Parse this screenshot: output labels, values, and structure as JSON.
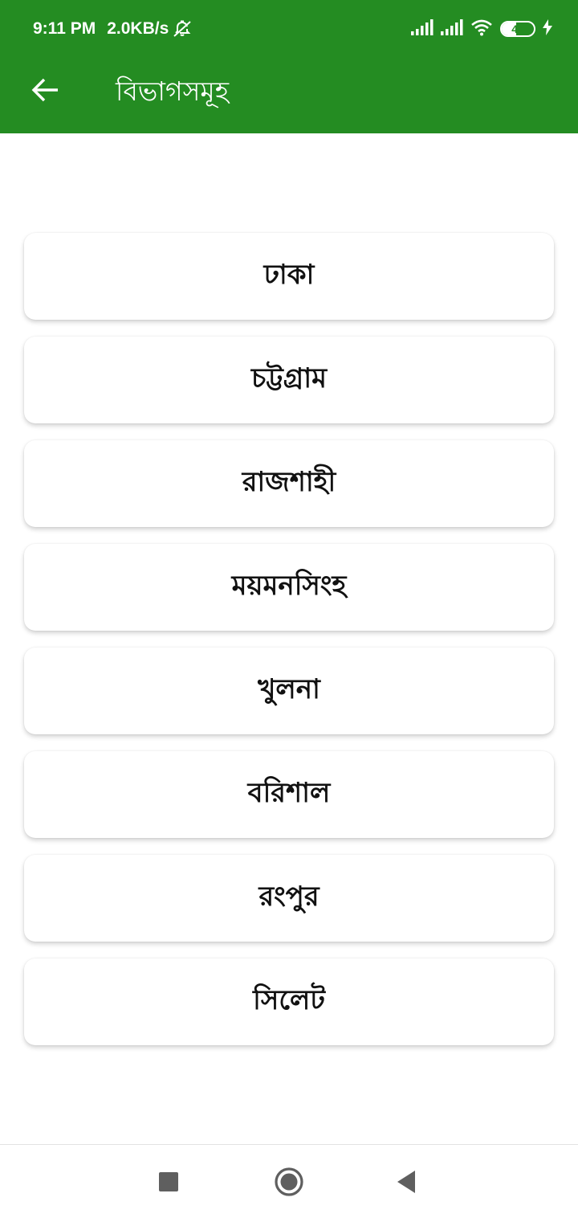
{
  "status_bar": {
    "time": "9:11 PM",
    "speed": "2.0KB/s",
    "battery_level": "44",
    "icons": [
      "mute-icon",
      "signal-icon",
      "signal-icon",
      "wifi-icon",
      "battery-icon",
      "charging-icon"
    ]
  },
  "app_bar": {
    "title": "বিভাগসমূহ",
    "back_icon": "arrow-left-icon"
  },
  "divisions": [
    "ঢাকা",
    "চট্টগ্রাম",
    "রাজশাহী",
    "ময়মনসিংহ",
    "খুলনা",
    "বরিশাল",
    "রংপুর",
    "সিলেট"
  ],
  "nav_bar": {
    "icons": [
      "recents-square-icon",
      "home-circle-icon",
      "back-triangle-icon"
    ]
  },
  "colors": {
    "primary": "#248c22",
    "card": "#ffffff",
    "text": "#111111"
  }
}
